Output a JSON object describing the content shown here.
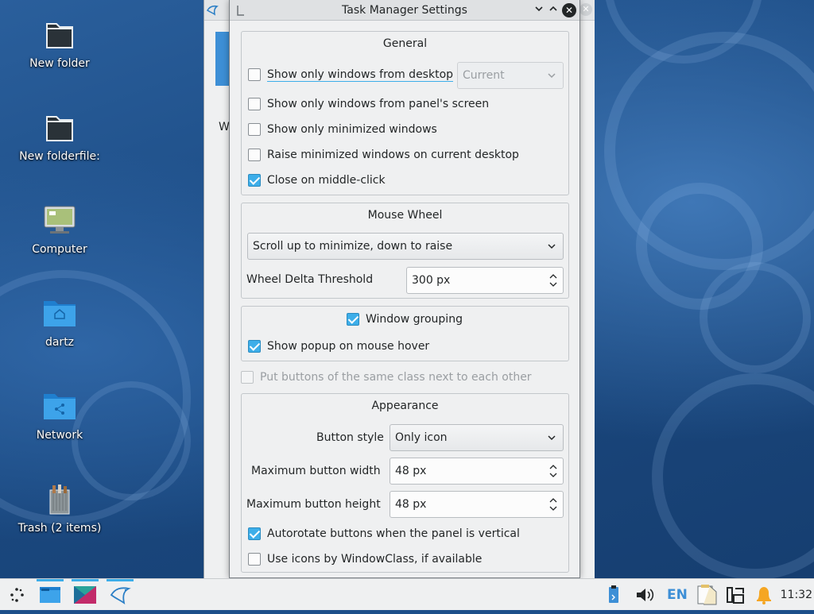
{
  "dialog": {
    "title": "Task Manager Settings",
    "general": {
      "title": "General",
      "show_only_desktop": {
        "label": "Show only windows from desktop",
        "checked": false
      },
      "desktop_combo": "Current",
      "show_only_screen": {
        "label": "Show only windows from panel's screen",
        "checked": false
      },
      "show_only_minimized": {
        "label": "Show only minimized windows",
        "checked": false
      },
      "raise_minimized": {
        "label": "Raise minimized windows on current desktop",
        "checked": false
      },
      "close_middle_click": {
        "label": "Close on middle-click",
        "checked": true
      }
    },
    "mouse_wheel": {
      "title": "Mouse Wheel",
      "mode": "Scroll up to minimize, down to raise",
      "threshold_label": "Wheel Delta Threshold",
      "threshold_value": "300 px"
    },
    "grouping": {
      "window_grouping": {
        "label": "Window grouping",
        "checked": true
      },
      "show_popup": {
        "label": "Show popup on mouse hover",
        "checked": true
      }
    },
    "same_class": {
      "label": "Put buttons of the same class next to each other",
      "checked": false
    },
    "appearance": {
      "title": "Appearance",
      "button_style_label": "Button style",
      "button_style_value": "Only icon",
      "max_width_label": "Maximum button width",
      "max_width_value": "48 px",
      "max_height_label": "Maximum button height",
      "max_height_value": "48 px",
      "autorotate": {
        "label": "Autorotate buttons when the panel is vertical",
        "checked": true
      },
      "window_class_icons": {
        "label": "Use icons by WindowClass, if available",
        "checked": false
      }
    }
  },
  "background_window": {
    "fragment": "W"
  },
  "desktop": {
    "icons": [
      {
        "label": "New folder",
        "icon": "folder-icon"
      },
      {
        "label": "New folderfile:",
        "icon": "folder-icon"
      },
      {
        "label": "Computer",
        "icon": "computer-icon"
      },
      {
        "label": "dartz",
        "icon": "home-folder-icon"
      },
      {
        "label": "Network",
        "icon": "network-folder-icon"
      },
      {
        "label": "Trash (2 items)",
        "icon": "trash-icon"
      }
    ]
  },
  "taskbar": {
    "language": "EN",
    "clock": "11:32"
  },
  "colors": {
    "accent": "#3daee9",
    "wallpaper": "#1d4f8a",
    "window_bg": "#eff0f1"
  }
}
